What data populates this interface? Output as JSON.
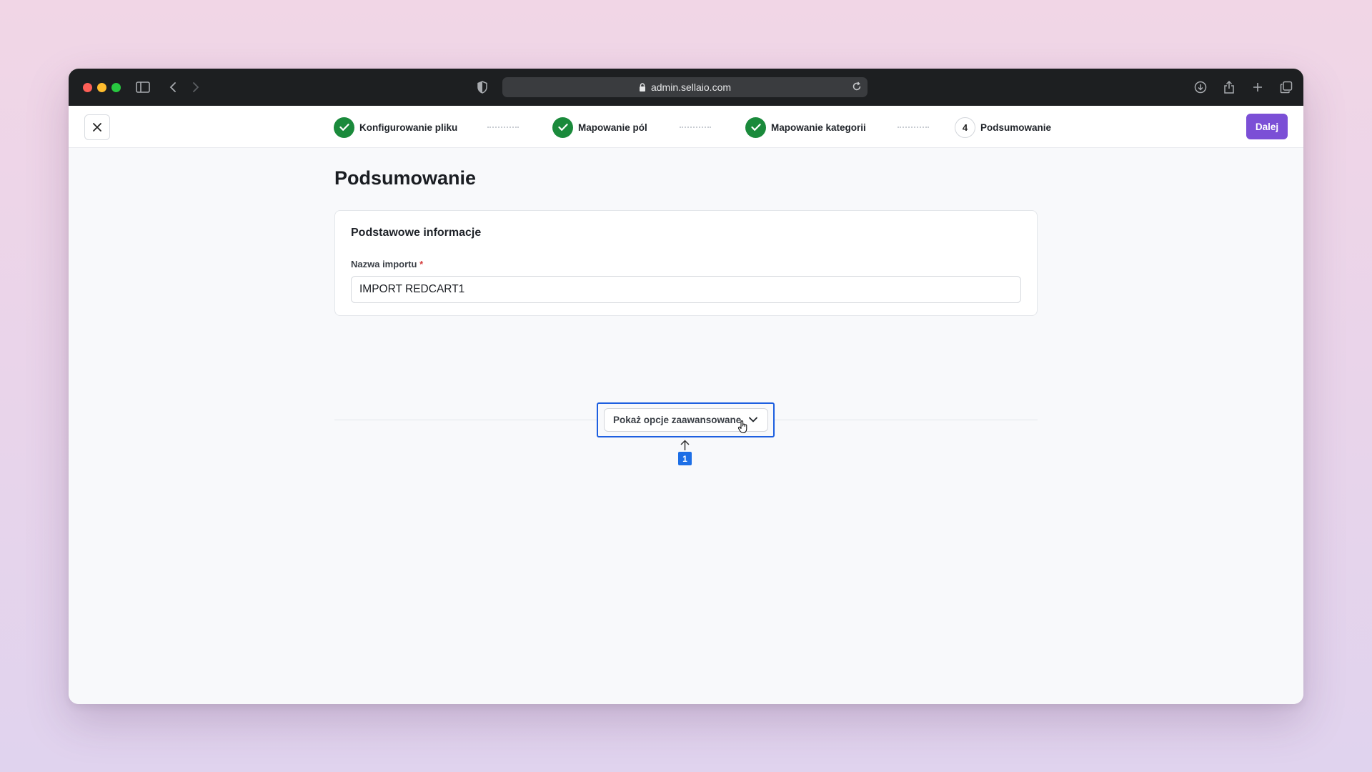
{
  "browser": {
    "url": "admin.sellaio.com"
  },
  "wizard": {
    "steps": [
      {
        "label": "Konfigurowanie pliku",
        "status": "completed"
      },
      {
        "label": "Mapowanie pól",
        "status": "completed"
      },
      {
        "label": "Mapowanie kategorii",
        "status": "completed"
      },
      {
        "number": "4",
        "label": "Podsumowanie",
        "status": "current"
      }
    ],
    "next_label": "Dalej"
  },
  "page": {
    "title": "Podsumowanie"
  },
  "card": {
    "title": "Podstawowe informacje",
    "field_label": "Nazwa importu",
    "required_mark": "*",
    "field_value": "IMPORT REDCART1"
  },
  "advanced": {
    "button_label": "Pokaż opcje zaawansowane"
  },
  "annotation": {
    "marker": "1"
  },
  "colors": {
    "accent": "#7b4fd6",
    "success": "#1a8a3b",
    "highlight": "#1d5fe0"
  }
}
